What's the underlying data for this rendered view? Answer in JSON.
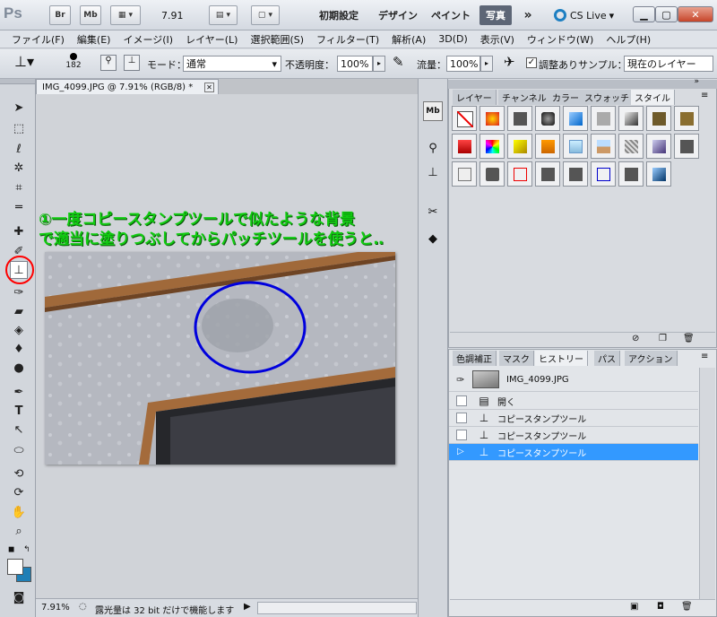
{
  "appbar": {
    "logo": "Ps",
    "bridge_btn": "Br",
    "minibridge_btn": "Mb",
    "zoom": "7.91",
    "workspaces": [
      "初期設定",
      "デザイン",
      "ペイント",
      "写真"
    ],
    "more": "»",
    "cslive": "CS Live"
  },
  "menu": [
    "ファイル(F)",
    "編集(E)",
    "イメージ(I)",
    "レイヤー(L)",
    "選択範囲(S)",
    "フィルター(T)",
    "解析(A)",
    "3D(D)",
    "表示(V)",
    "ウィンドウ(W)",
    "ヘルプ(H)"
  ],
  "options": {
    "brush_size": "182",
    "mode_label": "モード：",
    "mode_value": "通常",
    "opacity_label": "不透明度：",
    "opacity_value": "100%",
    "flow_label": "流量：",
    "flow_value": "100%",
    "aligned_label": "調整あり",
    "sample_label": "サンプル：",
    "sample_value": "現在のレイヤー"
  },
  "document": {
    "tab_title": "IMG_4099.JPG @ 7.91% (RGB/8) *",
    "caption_line1": "①一度コピースタンプツールで似たような背景",
    "caption_line2": "で適当に塗りつぶしてからパッチツールを使うと‥",
    "status_zoom": "7.91%",
    "status_text": "露光量は 32 bit だけで機能します"
  },
  "styles_panel": {
    "tabs": [
      "レイヤー",
      "チャンネル",
      "カラー",
      "スウォッチ",
      "スタイル"
    ],
    "active_tab": "スタイル"
  },
  "history_panel": {
    "tabs": [
      "色調補正",
      "マスク",
      "ヒストリー",
      "パス",
      "アクション"
    ],
    "active_tab": "ヒストリー",
    "snapshot": "IMG_4099.JPG",
    "items": [
      "開く",
      "コピースタンプツール",
      "コピースタンプツール",
      "コピースタンプツール"
    ]
  },
  "colors": {
    "annotation_circle": "#ff0000",
    "highlight_ellipse": "#0000dd",
    "caption_text": "#11cc11",
    "selection": "#3399ff"
  }
}
